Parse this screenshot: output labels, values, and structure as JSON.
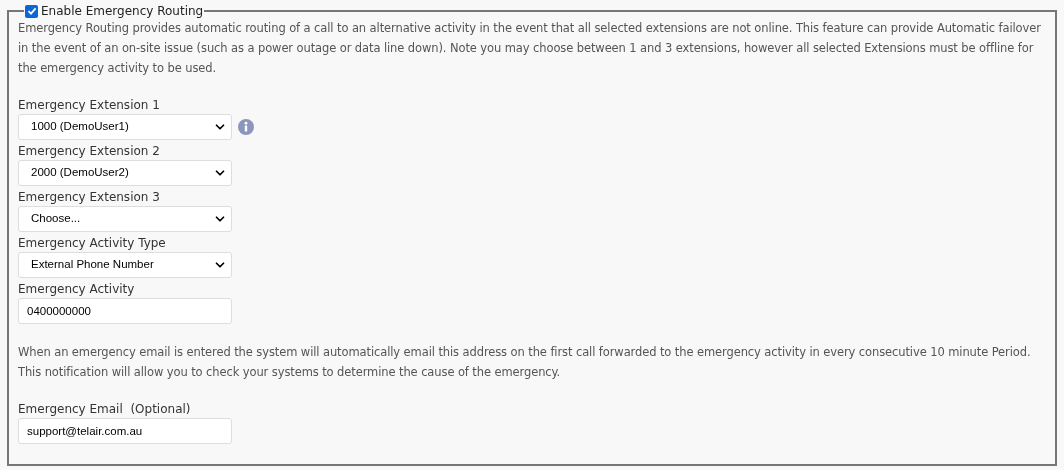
{
  "legend": {
    "label": "Enable Emergency Routing",
    "checked": true
  },
  "description": "Emergency Routing provides automatic routing of a call to an alternative activity in the event that all selected extensions are not online. This feature can provide Automatic failover in the event of an on-site issue (such as a power outage or data line down). Note you may choose between 1 and 3 extensions, however all selected Extensions must be offline for the emergency activity to be used.",
  "fields": [
    {
      "label": "Emergency Extension 1",
      "kind": "select",
      "value": "1000 (DemoUser1)",
      "info": true
    },
    {
      "label": "Emergency Extension 2",
      "kind": "select",
      "value": "2000 (DemoUser2)",
      "info": false
    },
    {
      "label": "Emergency Extension 3",
      "kind": "select",
      "value": "Choose...",
      "info": false
    },
    {
      "label": "Emergency Activity Type",
      "kind": "select",
      "value": "External Phone Number",
      "info": false
    },
    {
      "label": "Emergency Activity",
      "kind": "input",
      "value": "0400000000",
      "info": false
    }
  ],
  "email_note": "When an emergency email is entered the system will automatically email this address on the first call forwarded to the emergency activity in every consecutive 10 minute Period. This notification will allow you to check your systems to determine the cause of the emergency.",
  "email_field": {
    "label": "Emergency Email  (Optional)",
    "kind": "input",
    "value": "support@telair.com.au",
    "info": false
  }
}
